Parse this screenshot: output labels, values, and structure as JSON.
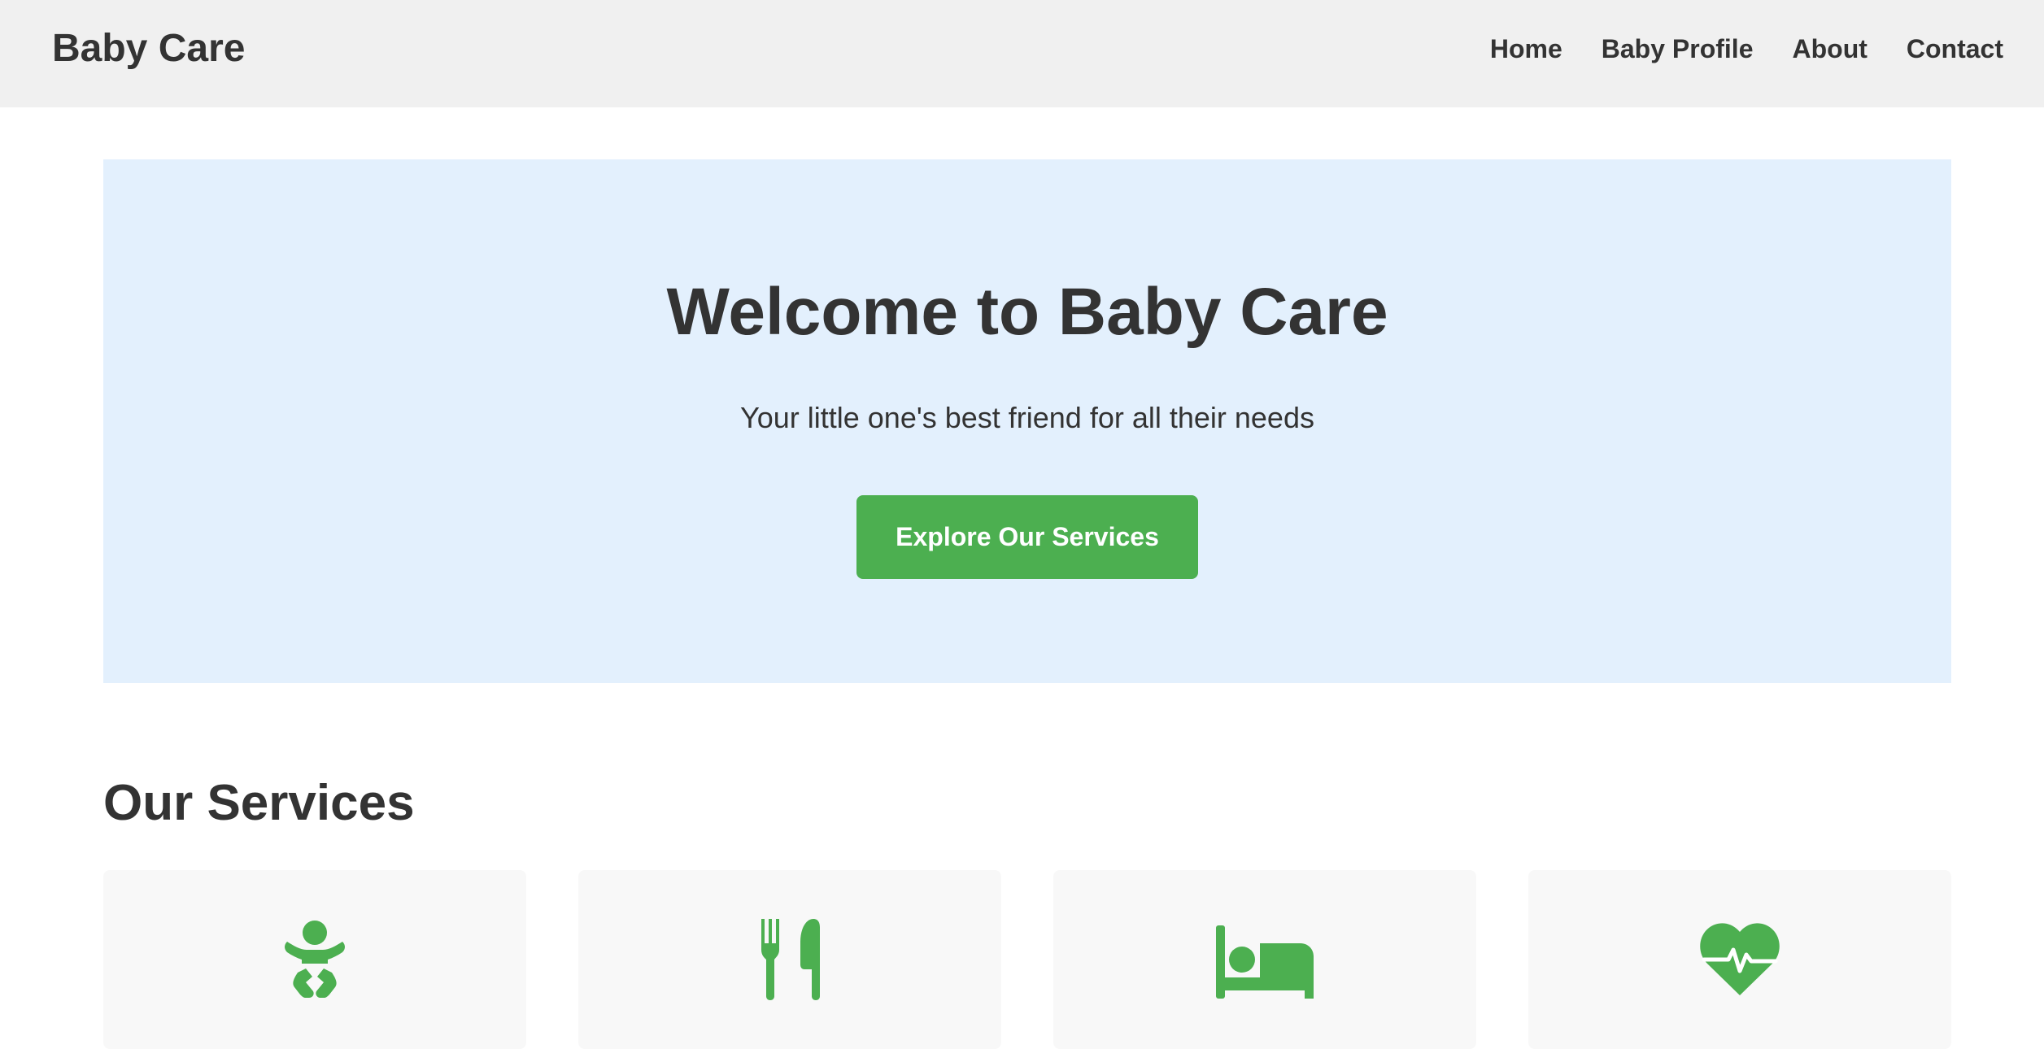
{
  "header": {
    "brand": "Baby Care",
    "nav": [
      {
        "label": "Home"
      },
      {
        "label": "Baby Profile"
      },
      {
        "label": "About"
      },
      {
        "label": "Contact"
      }
    ]
  },
  "hero": {
    "title": "Welcome to Baby Care",
    "subtitle": "Your little one's best friend for all their needs",
    "cta_label": "Explore Our Services"
  },
  "services": {
    "title": "Our Services",
    "cards": [
      {
        "icon": "baby-icon"
      },
      {
        "icon": "utensils-icon"
      },
      {
        "icon": "bed-icon"
      },
      {
        "icon": "heartbeat-icon"
      }
    ]
  },
  "colors": {
    "accent": "#4caf50",
    "hero_background": "#e3f0fd",
    "header_background": "#f0f0f0",
    "card_background": "#f8f8f8",
    "text": "#333333"
  }
}
